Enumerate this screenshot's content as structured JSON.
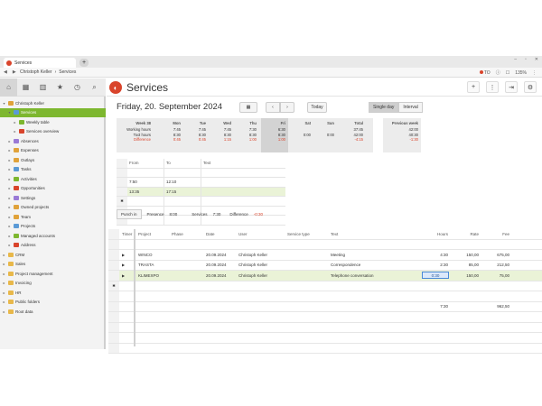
{
  "browser": {
    "tab_title": "Services",
    "breadcrumb": [
      "Christoph Keller",
      "Services"
    ],
    "zoom": "135%",
    "page_icon_label": "TO"
  },
  "app": {
    "title": "Services",
    "accent": "#7db72f",
    "brand": "#d9442b"
  },
  "sidebar": {
    "tools": [
      "home-icon",
      "calendar-icon",
      "chart-icon",
      "star-icon",
      "history-icon",
      "search-icon"
    ],
    "tree": [
      {
        "label": "Christoph Keller",
        "level": 0,
        "open": true
      },
      {
        "label": "Services",
        "level": 1,
        "selected": true
      },
      {
        "label": "Weekly table",
        "level": 2
      },
      {
        "label": "Services overview",
        "level": 2
      },
      {
        "label": "Absences",
        "level": 1
      },
      {
        "label": "Expenses",
        "level": 1
      },
      {
        "label": "Outlays",
        "level": 1
      },
      {
        "label": "Tasks",
        "level": 1
      },
      {
        "label": "Activities",
        "level": 1
      },
      {
        "label": "Opportunities",
        "level": 1
      },
      {
        "label": "Settings",
        "level": 1
      },
      {
        "label": "Owned projects",
        "level": 1
      },
      {
        "label": "Team",
        "level": 1
      },
      {
        "label": "Projects",
        "level": 1
      },
      {
        "label": "Managed accounts",
        "level": 1
      },
      {
        "label": "Address",
        "level": 1
      },
      {
        "label": "CRM",
        "level": 0
      },
      {
        "label": "Sales",
        "level": 0
      },
      {
        "label": "Project management",
        "level": 0
      },
      {
        "label": "Invoicing",
        "level": 0
      },
      {
        "label": "HR",
        "level": 0
      },
      {
        "label": "Public folders",
        "level": 0
      },
      {
        "label": "Root data",
        "level": 0
      }
    ]
  },
  "datebar": {
    "date": "Friday, 20. September 2024",
    "today": "Today",
    "single_day": "Single day",
    "interval": "Interval"
  },
  "week": {
    "label_col": {
      "head": "Week 38",
      "rows": [
        "Working hours",
        "Tool hours",
        "Difference"
      ]
    },
    "days": [
      {
        "head": "Mon",
        "rows": [
          "7:45",
          "8:30",
          "0:45"
        ]
      },
      {
        "head": "Tue",
        "rows": [
          "7:45",
          "8:30",
          "0:45"
        ]
      },
      {
        "head": "Wed",
        "rows": [
          "7:45",
          "8:30",
          "1:15"
        ]
      },
      {
        "head": "Thu",
        "rows": [
          "7:30",
          "8:30",
          "1:00"
        ]
      },
      {
        "head": "Fri",
        "rows": [
          "6:30",
          "8:30",
          "1:00"
        ]
      },
      {
        "head": "Sat",
        "rows": [
          "",
          "0:00",
          ""
        ]
      },
      {
        "head": "Sun",
        "rows": [
          "",
          "0:00",
          ""
        ]
      },
      {
        "head": "Total",
        "rows": [
          "37:45",
          "42:00",
          "-4:15"
        ]
      }
    ],
    "previous": {
      "head": "Previous week",
      "rows": [
        "42:00",
        "40:30",
        "-1:30"
      ]
    }
  },
  "timer": {
    "headers": [
      "From",
      "To",
      "Text"
    ],
    "rows": [
      {
        "from": "7:50",
        "to": "12:10",
        "text": ""
      },
      {
        "from": "13:35",
        "to": "17:15",
        "text": ""
      }
    ],
    "punch_in": "Punch in",
    "presence_label": "Presence",
    "presence": "8:00",
    "services_label": "Services",
    "services": "7:30",
    "difference_label": "Difference",
    "difference": "-0:30"
  },
  "services": {
    "headers": [
      "Timer",
      "Project",
      "Phase",
      "Date",
      "User",
      "Service type",
      "Text",
      "Hours",
      "Rate",
      "Fee"
    ],
    "rows": [
      {
        "project": "WINCO",
        "phase": "",
        "date": "20.09.2024",
        "user": "Christoph Keller",
        "type": "",
        "text": "Meeting",
        "hours": "4:30",
        "rate": "150,00",
        "fee": "675,00"
      },
      {
        "project": "TRASTA",
        "phase": "",
        "date": "20.09.2024",
        "user": "Christoph Keller",
        "type": "",
        "text": "Correspondence",
        "hours": "2:30",
        "rate": "85,00",
        "fee": "212,50"
      },
      {
        "project": "KLIMEXPO",
        "phase": "",
        "date": "20.09.2024",
        "user": "Christoph Keller",
        "type": "",
        "text": "Telephone conversation",
        "hours": "0:30",
        "rate": "150,00",
        "fee": "75,00"
      }
    ],
    "total_hours": "7:30",
    "total_fee": "962,50"
  }
}
